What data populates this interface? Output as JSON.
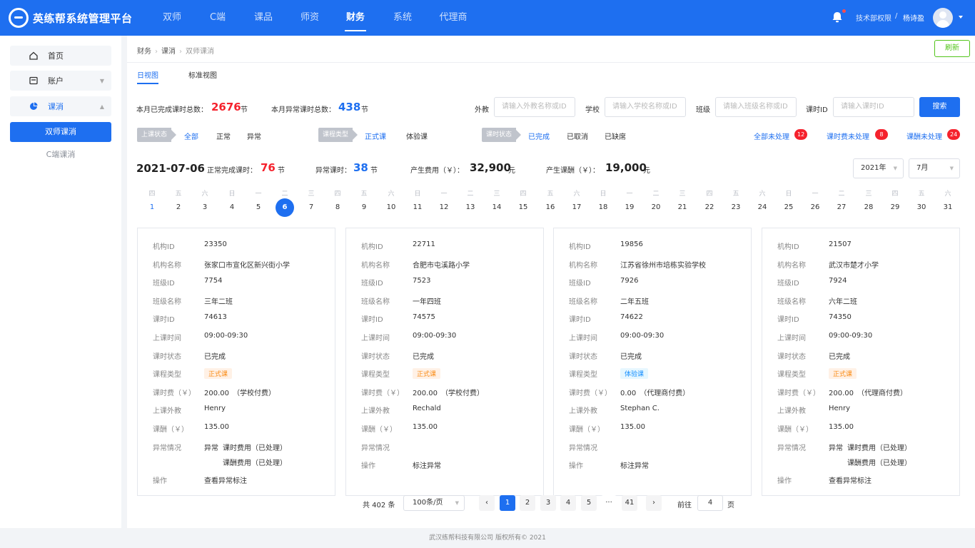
{
  "header": {
    "brand": "英练帮系统管理平台",
    "nav": [
      "双师",
      "C端",
      "课品",
      "师资",
      "财务",
      "系统",
      "代理商"
    ],
    "active_nav": "财务",
    "user_dept": "技术部权限",
    "user_sep": "/",
    "user_name": "杨诗盈"
  },
  "sidebar": {
    "items": [
      {
        "label": "首页",
        "icon": "home-icon"
      },
      {
        "label": "账户",
        "icon": "wallet-icon"
      },
      {
        "label": "课消",
        "icon": "pie-chart-icon"
      }
    ],
    "sub_active": "双师课消",
    "sub_other": "C端课消"
  },
  "breadcrumb": {
    "l1": "财务",
    "l2": "课消",
    "l3": "双师课消"
  },
  "refresh_label": "刷新",
  "tabs": {
    "day": "日视图",
    "standard": "标准视图"
  },
  "monthly": {
    "completed_label": "本月已完成课时总数：",
    "completed_value": "2676",
    "abnormal_label": "本月异常课时总数：",
    "abnormal_value": "438",
    "unit": "节"
  },
  "filters": {
    "teacher_label": "外教",
    "teacher_placeholder": "请输入外教名称或ID",
    "school_label": "学校",
    "school_placeholder": "请输入学校名称或ID",
    "class_label": "班级",
    "class_placeholder": "请输入班级名称或ID",
    "lesson_label": "课时ID",
    "lesson_placeholder": "请输入课时ID",
    "search": "搜索"
  },
  "status_filters": {
    "class_status_label": "上课状态",
    "class_status_options": [
      "全部",
      "正常",
      "异常"
    ],
    "course_type_label": "课程类型",
    "course_type_options": [
      "正式课",
      "体验课"
    ],
    "lesson_status_label": "课时状态",
    "lesson_status_options": [
      "已完成",
      "已取消",
      "已缺席"
    ]
  },
  "pending": [
    {
      "label": "全部未处理",
      "count": "12"
    },
    {
      "label": "课时费未处理",
      "count": "8"
    },
    {
      "label": "课酬未处理",
      "count": "24"
    }
  ],
  "day_summary": {
    "date": "2021-07-06",
    "normal_label": "正常完成课时：",
    "normal_value": "76",
    "normal_unit": "节",
    "abnormal_label": "异常课时：",
    "abnormal_value": "38",
    "abnormal_unit": "节",
    "fee_label": "产生费用（￥）：",
    "fee_value": "32,900",
    "fee_unit": "元",
    "pay_label": "产生课酬（￥）：",
    "pay_value": "19,000",
    "pay_unit": "元"
  },
  "year_select": "2021年",
  "month_select": "7月",
  "calendar": {
    "weekdays": [
      "四",
      "五",
      "六",
      "日",
      "一",
      "二",
      "三",
      "四",
      "五",
      "六",
      "日",
      "一",
      "二",
      "三",
      "四",
      "五",
      "六",
      "日",
      "一",
      "二",
      "三",
      "四",
      "五",
      "六",
      "日",
      "一",
      "二",
      "三",
      "四",
      "五",
      "六"
    ],
    "days": [
      "1",
      "2",
      "3",
      "4",
      "5",
      "6",
      "7",
      "8",
      "9",
      "10",
      "11",
      "12",
      "13",
      "14",
      "15",
      "16",
      "17",
      "18",
      "19",
      "20",
      "21",
      "22",
      "23",
      "24",
      "25",
      "26",
      "27",
      "28",
      "29",
      "30",
      "31"
    ],
    "selected": "6"
  },
  "field_labels": {
    "org_id": "机构ID",
    "org_name": "机构名称",
    "class_id": "班级ID",
    "class_name": "班级名称",
    "lesson_id": "课时ID",
    "time": "上课时间",
    "status": "课时状态",
    "type": "课程类型",
    "fee": "课时费（￥）",
    "teacher": "上课外教",
    "pay": "课酬（￥）",
    "abnormal": "异常情况",
    "action": "操作"
  },
  "cards": [
    {
      "org_id": "23350",
      "org_name": "张家口市宣化区新兴街小学",
      "class_id": "7754",
      "class_name": "三年二班",
      "lesson_id": "74613",
      "time": "09:00-09:30",
      "status": "已完成",
      "type": "正式课",
      "fee": "200.00　（学校付费）",
      "teacher": "Henry",
      "pay": "135.00",
      "abnormal_tag": "异常",
      "abnormal_lines": [
        "课时费用（已处理）",
        "课酬费用（已处理）"
      ],
      "action": "查看异常标注"
    },
    {
      "org_id": "22711",
      "org_name": "合肥市屯溪路小学",
      "class_id": "7523",
      "class_name": "一年四班",
      "lesson_id": "74575",
      "time": "09:00-09:30",
      "status": "已完成",
      "type": "正式课",
      "fee": "200.00　（学校付费）",
      "teacher": "Rechald",
      "pay": "135.00",
      "abnormal_tag": "",
      "abnormal_lines": [],
      "action": "标注异常"
    },
    {
      "org_id": "19856",
      "org_name": "江苏省徐州市培栋实验学校",
      "class_id": "7926",
      "class_name": "二年五班",
      "lesson_id": "74622",
      "time": "09:00-09:30",
      "status": "已完成",
      "type": "体验课",
      "fee": "0.00　（代理商付费）",
      "teacher": "Stephan C.",
      "pay": "135.00",
      "abnormal_tag": "",
      "abnormal_lines": [],
      "action": "标注异常"
    },
    {
      "org_id": "21507",
      "org_name": "武汉市楚才小学",
      "class_id": "7924",
      "class_name": "六年二班",
      "lesson_id": "74350",
      "time": "09:00-09:30",
      "status": "已完成",
      "type": "正式课",
      "fee": "200.00　（代理商付费）",
      "teacher": "Henry",
      "pay": "135.00",
      "abnormal_tag": "异常",
      "abnormal_lines": [
        "课时费用（已处理）",
        "课酬费用（已处理）"
      ],
      "action": "查看异常标注"
    }
  ],
  "pagination": {
    "total": "共 402 条",
    "page_size": "100条/页",
    "prev": "‹",
    "pages": [
      "1",
      "2",
      "3",
      "4",
      "5"
    ],
    "ellipsis": "···",
    "last": "41",
    "next": "›",
    "goto_label": "前往",
    "goto_value": "4",
    "goto_unit": "页",
    "current": "1"
  },
  "footer": "武汉练帮科技有限公司 版权所有© 2021"
}
